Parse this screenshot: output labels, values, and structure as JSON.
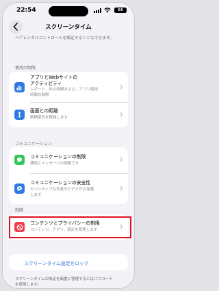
{
  "status_bar": {
    "time": "22:54",
    "battery": "66"
  },
  "nav": {
    "title": "スクリーンタイム"
  },
  "intro_text": "ペアレンタルコントロールを設定することもできます。",
  "sections": {
    "usage": {
      "header": "使用の制限",
      "items": [
        {
          "title_line1": "アプリとWebサイトの",
          "title_line2": "アクティビティ",
          "subtitle_line1": "レポート、休止時間および、アプリ使用",
          "subtitle_line2": "時間の制限",
          "icon": "chart-bars-icon",
          "color": "#2f7ae5"
        },
        {
          "title": "画面との距離",
          "subtitle": "眼精疲労を軽減します",
          "icon": "distance-arrows-icon",
          "color": "#2f7ae5"
        }
      ]
    },
    "communication": {
      "header": "コミュニケーション",
      "items": [
        {
          "title": "コミュニケーションの制限",
          "subtitle": "通話とメッセージの制限です",
          "icon": "chat-bubble-icon",
          "color": "#34c759"
        },
        {
          "title": "コミュニケーションの安全性",
          "subtitle_line1": "センシティブな写真やビデオから保護",
          "subtitle_line2": "します",
          "icon": "chat-shield-icon",
          "color": "#2f7ae5"
        }
      ]
    },
    "restrictions": {
      "header": "制限",
      "items": [
        {
          "title": "コンテンツとプライバシーの制限",
          "subtitle": "コンテンツ、アプリ、設定を管理します",
          "icon": "no-entry-icon",
          "color": "#ef3b4a"
        }
      ]
    }
  },
  "lock_link": "スクリーンタイム設定をロック",
  "footer_text_line1": "スクリーンタイムの設定を厳重に管理するにはパスコード",
  "footer_text_line2": "を使用します。"
}
